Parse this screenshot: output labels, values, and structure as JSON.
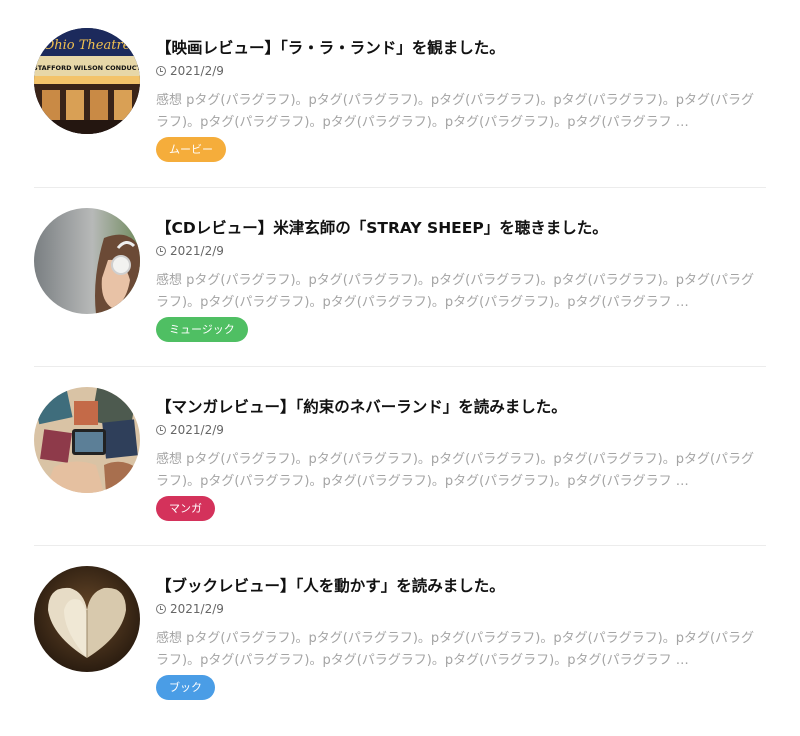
{
  "posts": [
    {
      "title": "【映画レビュー】「ラ・ラ・ランド」を観ました。",
      "date": "2021/2/9",
      "excerpt": "感想 pタグ(パラグラフ)。pタグ(パラグラフ)。pタグ(パラグラフ)。pタグ(パラグラフ)。pタグ(パラグラフ)。pタグ(パラグラフ)。pタグ(パラグラフ)。pタグ(パラグラフ)。pタグ(パラグラフ …",
      "category": "ムービー",
      "category_color": "#f5ad3b",
      "thumb_sign_text": "Ohio Theatre",
      "thumb_marquee_text": "STAFFORD WILSON CONDUCT"
    },
    {
      "title": "【CDレビュー】米津玄師の「STRAY SHEEP」を聴きました。",
      "date": "2021/2/9",
      "excerpt": "感想 pタグ(パラグラフ)。pタグ(パラグラフ)。pタグ(パラグラフ)。pタグ(パラグラフ)。pタグ(パラグラフ)。pタグ(パラグラフ)。pタグ(パラグラフ)。pタグ(パラグラフ)。pタグ(パラグラフ …",
      "category": "ミュージック",
      "category_color": "#4fbf63"
    },
    {
      "title": "【マンガレビュー】「約束のネバーランド」を読みました。",
      "date": "2021/2/9",
      "excerpt": "感想 pタグ(パラグラフ)。pタグ(パラグラフ)。pタグ(パラグラフ)。pタグ(パラグラフ)。pタグ(パラグラフ)。pタグ(パラグラフ)。pタグ(パラグラフ)。pタグ(パラグラフ)。pタグ(パラグラフ …",
      "category": "マンガ",
      "category_color": "#d4325b"
    },
    {
      "title": "【ブックレビュー】「人を動かす」を読みました。",
      "date": "2021/2/9",
      "excerpt": "感想 pタグ(パラグラフ)。pタグ(パラグラフ)。pタグ(パラグラフ)。pタグ(パラグラフ)。pタグ(パラグラフ)。pタグ(パラグラフ)。pタグ(パラグラフ)。pタグ(パラグラフ)。pタグ(パラグラフ …",
      "category": "ブック",
      "category_color": "#4a9de6"
    }
  ]
}
